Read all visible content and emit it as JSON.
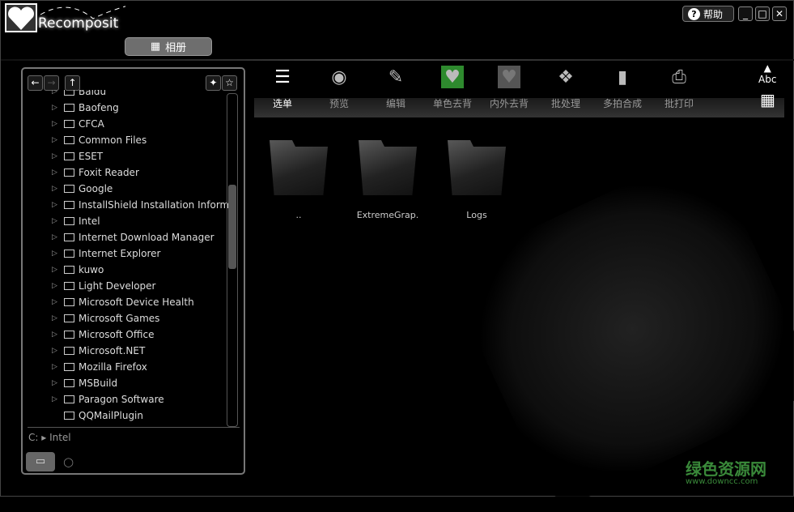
{
  "app": {
    "title": "Recomposit",
    "help": "帮助",
    "album": "相册"
  },
  "toolbar": [
    {
      "label": "选单",
      "icon": "menu-doc-icon"
    },
    {
      "label": "预览",
      "icon": "eye-icon"
    },
    {
      "label": "编辑",
      "icon": "edit-icon"
    },
    {
      "label": "单色去背",
      "icon": "green-heart-icon"
    },
    {
      "label": "内外去背",
      "icon": "checker-heart-icon"
    },
    {
      "label": "批处理",
      "icon": "stack-icon"
    },
    {
      "label": "多拍合成",
      "icon": "cards-icon"
    },
    {
      "label": "批打印",
      "icon": "printer-icon"
    }
  ],
  "text_toggle": "Abc",
  "tree": [
    "Baidu",
    "Baofeng",
    "CFCA",
    "Common Files",
    "ESET",
    "Foxit Reader",
    "Google",
    "InstallShield Installation Information",
    "Intel",
    "Internet Download Manager",
    "Internet Explorer",
    "kuwo",
    "Light Developer",
    "Microsoft Device Health",
    "Microsoft Games",
    "Microsoft Office",
    "Microsoft.NET",
    "Mozilla Firefox",
    "MSBuild",
    "Paragon Software",
    "QQMailPlugin"
  ],
  "path": "C: ▸ Intel",
  "files": [
    "..",
    "ExtremeGrap.",
    "Logs"
  ],
  "watermark": {
    "name": "绿色资源网",
    "url": "www.downcc.com"
  }
}
